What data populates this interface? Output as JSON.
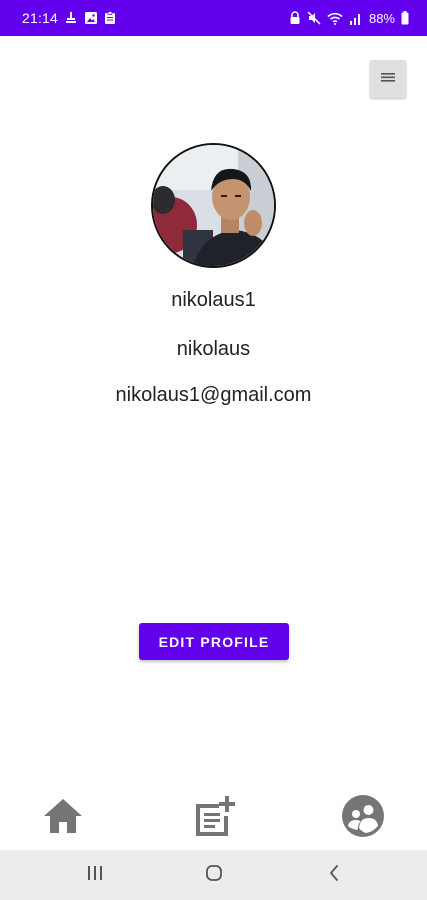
{
  "status_bar": {
    "time": "21:14",
    "battery": "88%",
    "left_icons": [
      "usb-debug-icon",
      "gallery-icon",
      "clipboard-icon"
    ],
    "right_icons": [
      "lock-icon",
      "mute-icon",
      "wifi-icon",
      "signal-icon",
      "battery-icon"
    ]
  },
  "colors": {
    "primary": "#6200EE",
    "nav_icon": "#757575",
    "system_nav_bg": "#ececec"
  },
  "toolbar": {
    "menu_icon": "hamburger-menu-icon"
  },
  "profile": {
    "avatar": "profile-photo",
    "username": "nikolaus1",
    "name": "nikolaus",
    "email": "nikolaus1@gmail.com"
  },
  "actions": {
    "edit_profile_label": "EDIT PROFILE"
  },
  "bottom_nav": {
    "items": [
      {
        "icon": "home-icon"
      },
      {
        "icon": "add-post-icon"
      },
      {
        "icon": "profile-icon"
      }
    ]
  },
  "system_nav": {
    "items": [
      "recents-icon",
      "home-circle-icon",
      "back-icon"
    ]
  }
}
